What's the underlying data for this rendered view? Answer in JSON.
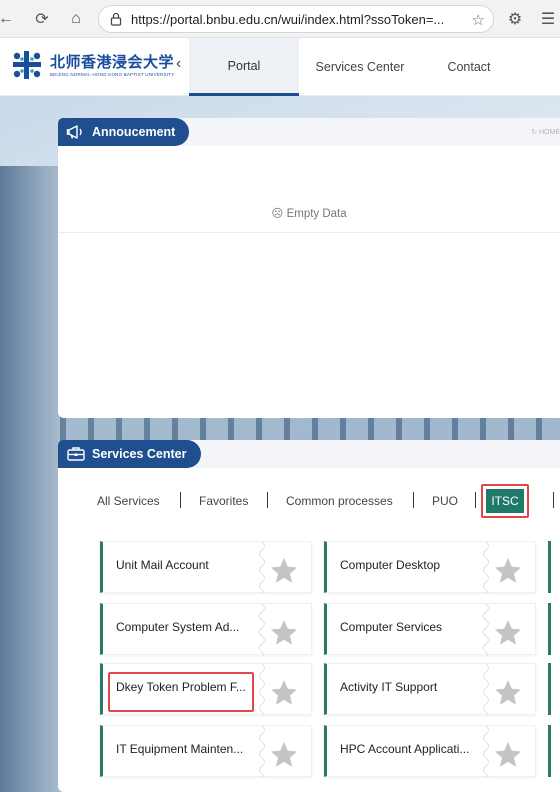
{
  "browser": {
    "url": "https://portal.bnbu.edu.cn/wui/index.html?ssoToken=..."
  },
  "header": {
    "logo_text_cn": "北师香港浸会大学",
    "logo_text_en": "BEIJING NORMAL-HONG KONG BAPTIST UNIVERSITY",
    "nav": [
      "Portal",
      "Services Center",
      "Contact"
    ]
  },
  "announcement": {
    "title": "Annoucement",
    "home_link": "HOME",
    "empty": "Empty Data"
  },
  "services": {
    "title": "Services Center",
    "tabs": [
      "All Services",
      "Favorites",
      "Common processes",
      "PUO",
      "ITSC"
    ],
    "active_tab": "ITSC",
    "items": [
      "Unit Mail Account",
      "Computer Desktop",
      "Computer System Ad...",
      "Computer Services",
      "Dkey Token Problem F...",
      "Activity IT Support",
      "IT Equipment Mainten...",
      "HPC Account Applicati..."
    ]
  },
  "colors": {
    "brand_blue": "#1f4f8f",
    "itsc_green": "#1f7a6a",
    "item_accent": "#2a7a64",
    "highlight_red": "#e04848"
  }
}
